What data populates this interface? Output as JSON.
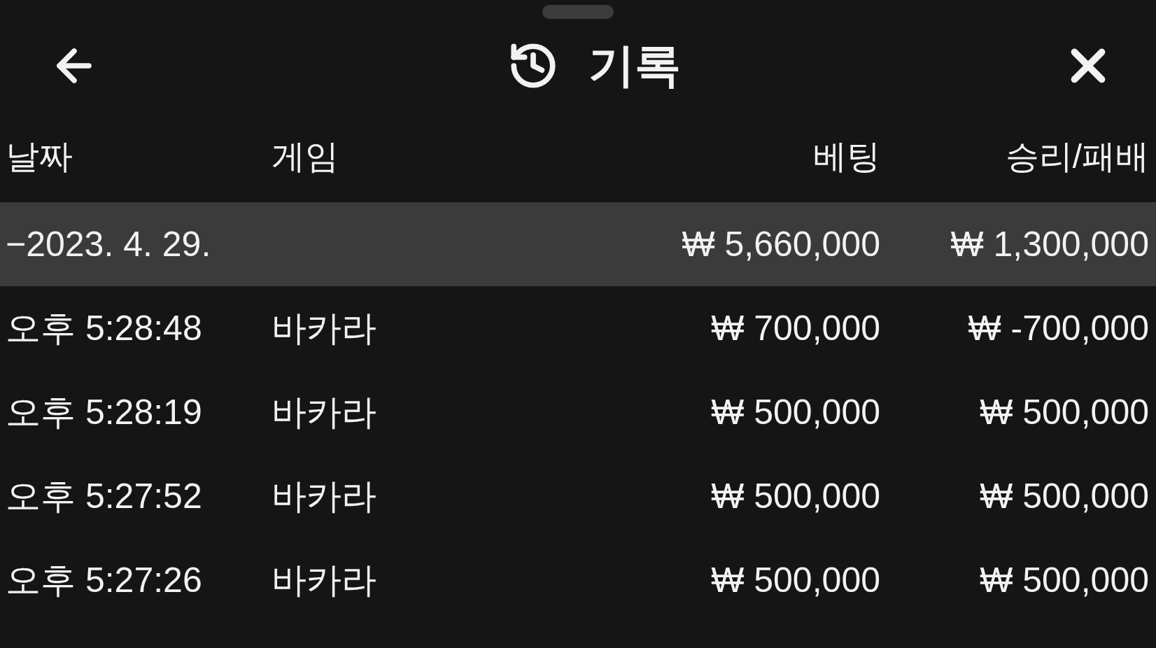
{
  "header": {
    "title": "기록"
  },
  "table": {
    "columns": [
      "날짜",
      "게임",
      "베팅",
      "승리/패배"
    ],
    "summary": {
      "date": "−2023. 4. 29.",
      "bet": "₩ 5,660,000",
      "result": "₩ 1,300,000",
      "selected": true
    },
    "rows": [
      {
        "time": "오후 5:28:48",
        "game": "바카라",
        "bet": "₩ 700,000",
        "result": "₩ -700,000"
      },
      {
        "time": "오후 5:28:19",
        "game": "바카라",
        "bet": "₩ 500,000",
        "result": "₩ 500,000"
      },
      {
        "time": "오후 5:27:52",
        "game": "바카라",
        "bet": "₩ 500,000",
        "result": "₩ 500,000"
      },
      {
        "time": "오후 5:27:26",
        "game": "바카라",
        "bet": "₩ 500,000",
        "result": "₩ 500,000"
      }
    ]
  }
}
